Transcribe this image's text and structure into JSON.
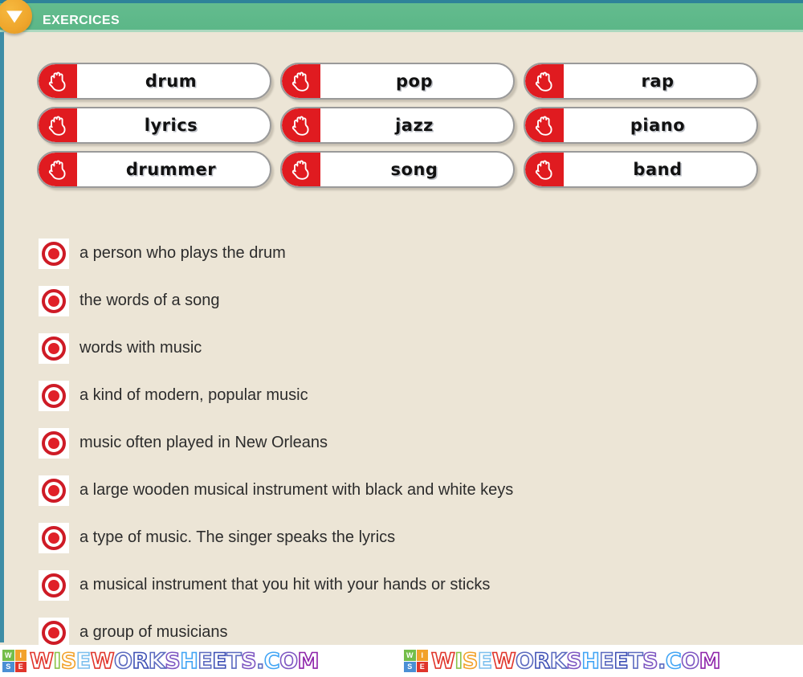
{
  "header": {
    "title": "EXERCICES",
    "badge_icon": "down-triangle-icon",
    "bar_color": "#5BB687",
    "accent_color": "#2E8399",
    "badge_color": "#EFA62C"
  },
  "page": {
    "background_color": "#ECE5D6"
  },
  "words": {
    "hand_icon": "hand-icon",
    "rows": [
      [
        {
          "label": "drum"
        },
        {
          "label": "pop"
        },
        {
          "label": "rap"
        }
      ],
      [
        {
          "label": "lyrics"
        },
        {
          "label": "jazz"
        },
        {
          "label": "piano"
        }
      ],
      [
        {
          "label": "drummer"
        },
        {
          "label": "song"
        },
        {
          "label": "band"
        }
      ]
    ]
  },
  "definitions": {
    "radio_color": "#E02028",
    "items": [
      {
        "text": "a person who plays the drum"
      },
      {
        "text": "the words of a song"
      },
      {
        "text": "words with music"
      },
      {
        "text": "a kind of modern, popular music"
      },
      {
        "text": "music often played in New Orleans"
      },
      {
        "text": "a large wooden musical instrument with black and white keys"
      },
      {
        "text": "a type of music. The singer speaks the lyrics"
      },
      {
        "text": "a musical instrument that you hit with your hands or sticks"
      },
      {
        "text": "a group of musicians"
      }
    ]
  },
  "footer": {
    "logo_tiles": [
      {
        "letter": "W",
        "color": "#74BE4A"
      },
      {
        "letter": "I",
        "color": "#F2A22B"
      },
      {
        "letter": "S",
        "color": "#4A8FD4"
      },
      {
        "letter": "E",
        "color": "#E0352B"
      }
    ],
    "watermark_text": "WISEWORKSHEETS.COM",
    "repeat": 2,
    "letter_colors": [
      "#E0352B",
      "#8BC34A",
      "#F2A22B",
      "#7EC0EE",
      "#E0352B",
      "#5C6BC0",
      "#3F51B5",
      "#5C6BC0",
      "#7E57C2",
      "#42A5F5",
      "#5C6BC0",
      "#3F51B5",
      "#5C6BC0",
      "#7E57C2",
      "#5C6BC0",
      "#42A5F5",
      "#7E57C2",
      "#8E24AA"
    ]
  }
}
